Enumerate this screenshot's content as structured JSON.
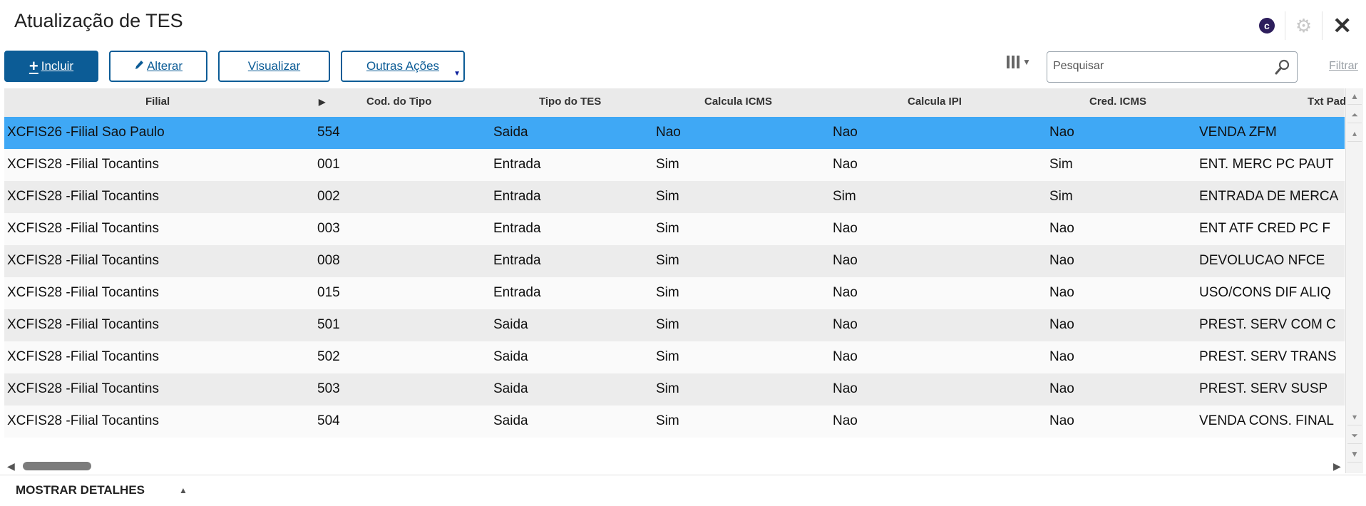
{
  "header": {
    "title": "Atualização de TES",
    "logo_letter": "c"
  },
  "toolbar": {
    "incluir": "Incluir",
    "alterar": "Alterar",
    "visualizar": "Visualizar",
    "outras_acoes": "Outras Ações",
    "search_placeholder": "Pesquisar",
    "filtrar": "Filtrar"
  },
  "grid": {
    "columns": [
      "Filial",
      "Cod. do Tipo",
      "Tipo do TES",
      "Calcula ICMS",
      "Calcula IPI",
      "Cred. ICMS",
      "Txt Pad"
    ],
    "rows": [
      [
        "XCFIS26 -Filial Sao Paulo",
        "554",
        "Saida",
        "Nao",
        "Nao",
        "Nao",
        "VENDA ZFM"
      ],
      [
        "XCFIS28 -Filial Tocantins",
        "001",
        "Entrada",
        "Sim",
        "Nao",
        "Sim",
        "ENT. MERC PC PAUT"
      ],
      [
        "XCFIS28 -Filial Tocantins",
        "002",
        "Entrada",
        "Sim",
        "Sim",
        "Sim",
        "ENTRADA DE MERCA"
      ],
      [
        "XCFIS28 -Filial Tocantins",
        "003",
        "Entrada",
        "Sim",
        "Nao",
        "Nao",
        "ENT ATF CRED PC F"
      ],
      [
        "XCFIS28 -Filial Tocantins",
        "008",
        "Entrada",
        "Sim",
        "Nao",
        "Nao",
        "DEVOLUCAO NFCE"
      ],
      [
        "XCFIS28 -Filial Tocantins",
        "015",
        "Entrada",
        "Sim",
        "Nao",
        "Nao",
        "USO/CONS DIF ALIQ"
      ],
      [
        "XCFIS28 -Filial Tocantins",
        "501",
        "Saida",
        "Sim",
        "Nao",
        "Nao",
        "PREST. SERV COM C"
      ],
      [
        "XCFIS28 -Filial Tocantins",
        "502",
        "Saida",
        "Sim",
        "Nao",
        "Nao",
        "PREST. SERV TRANS"
      ],
      [
        "XCFIS28 -Filial Tocantins",
        "503",
        "Saida",
        "Sim",
        "Nao",
        "Nao",
        "PREST. SERV SUSP"
      ],
      [
        "XCFIS28 -Filial Tocantins",
        "504",
        "Saida",
        "Sim",
        "Nao",
        "Nao",
        "VENDA CONS. FINAL"
      ]
    ],
    "selected_row": 0
  },
  "footer": {
    "details": "MOSTRAR DETALHES"
  },
  "colors": {
    "primary": "#0c5c96",
    "selection": "#3fa8f5",
    "logo": "#2d1e5c"
  }
}
